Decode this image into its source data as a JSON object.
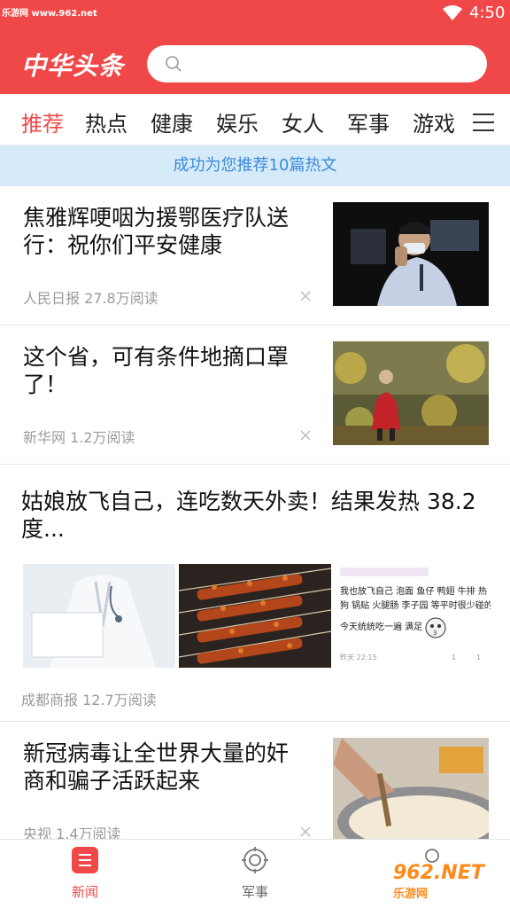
{
  "status_bar": {
    "watermark": "乐游网 www.962.net",
    "time": "4:50"
  },
  "header": {
    "logo": "中华头条",
    "search_placeholder": ""
  },
  "tabs": [
    {
      "label": "推荐",
      "active": true
    },
    {
      "label": "热点"
    },
    {
      "label": "健康"
    },
    {
      "label": "娱乐"
    },
    {
      "label": "女人"
    },
    {
      "label": "军事"
    },
    {
      "label": "游戏"
    }
  ],
  "banner": "成功为您推荐10篇热文",
  "feed": [
    {
      "title_l1": "焦雅辉哽咽为援鄂医疗队送",
      "title_l2": "行：祝你们平安健康",
      "meta": "人民日报 27.8万阅读"
    },
    {
      "title_l1": "这个省，可有条件地摘口罩",
      "title_l2": "了！",
      "meta": "新华网 1.2万阅读"
    },
    {
      "title_l1": "姑娘放飞自己，连吃数天外卖！结果发热 38.2",
      "title_l2": "度...",
      "meta": "成都商报 12.7万阅读",
      "post_text_l1": "我也放飞自己 泡面 鱼仔 鸭翅 牛排 热",
      "post_text_l2": "狗 锅贴 火腿肠 李子园 等平时很少碰的",
      "post_text_l3": "今天统统吃一遍 满足",
      "post_time": "昨天 22:15",
      "post_likes": "1",
      "post_comments": "1",
      "post_sticker_num": "3"
    },
    {
      "title_l1": "新冠病毒让全世界大量的奸",
      "title_l2": "商和骗子活跃起来",
      "meta": "央视 1.4万阅读"
    }
  ],
  "bottom_nav": [
    {
      "label": "新闻",
      "active": true
    },
    {
      "label": "军事"
    }
  ],
  "brand_mark": {
    "main": "962.NET",
    "sub": "乐游网"
  },
  "colors": {
    "accent": "#f04848",
    "banner_bg": "#d6ebfa",
    "banner_text": "#3b8ad8"
  }
}
